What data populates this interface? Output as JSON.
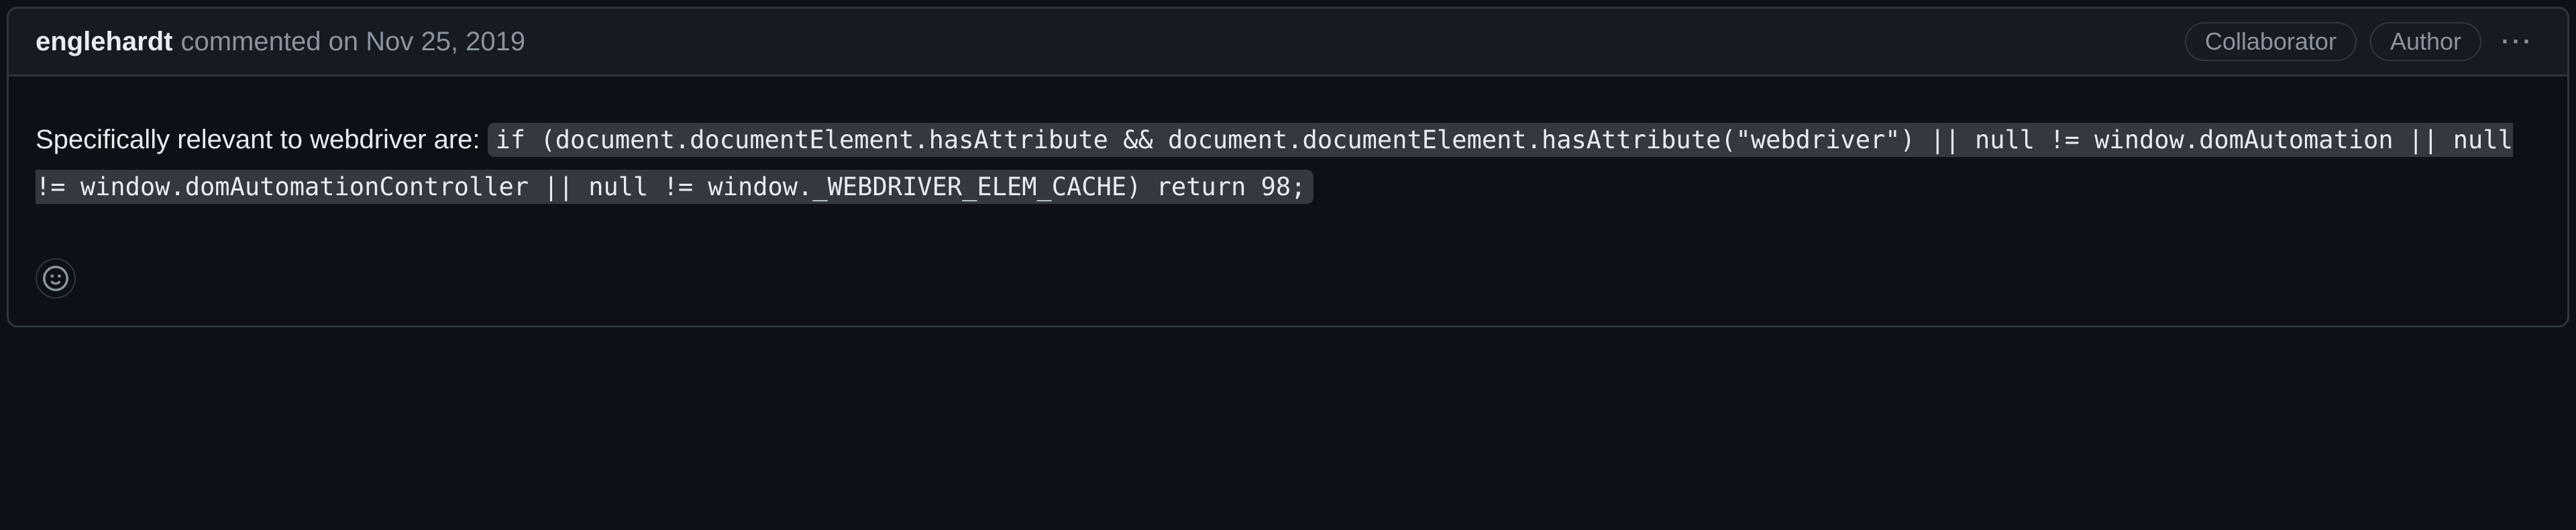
{
  "comment": {
    "author": "englehardt",
    "action_text": "commented",
    "timestamp_prefix": "on",
    "timestamp": "Nov 25, 2019",
    "badges": {
      "collaborator": "Collaborator",
      "author": "Author"
    },
    "body": {
      "lead_text": "Specifically relevant to webdriver are: ",
      "code": "if (document.documentElement.hasAttribute && document.documentElement.hasAttribute(\"webdriver\") || null != window.domAutomation || null != window.domAutomationController || null != window._WEBDRIVER_ELEM_CACHE) return 98;"
    }
  },
  "icons": {
    "kebab": "···",
    "reaction": "smiley-icon"
  }
}
